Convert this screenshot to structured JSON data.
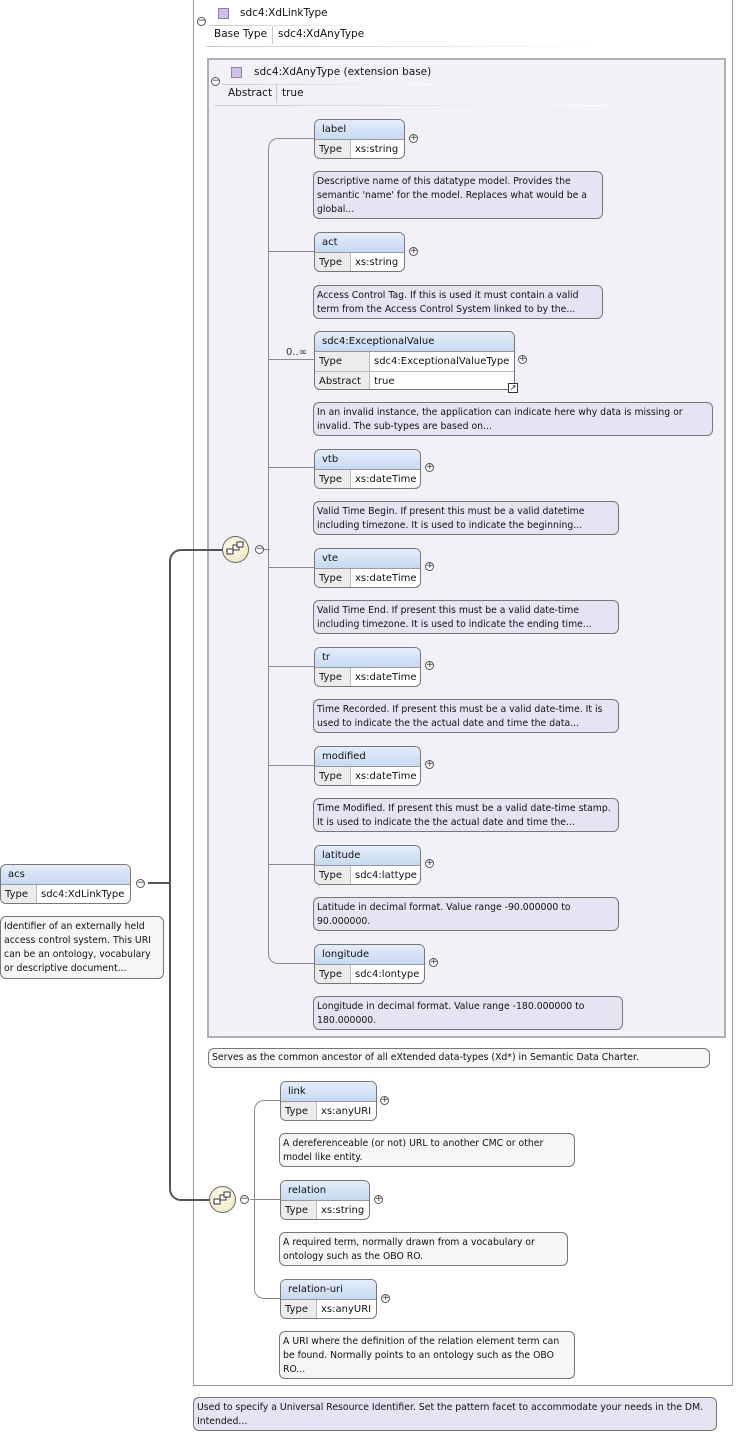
{
  "outer_type": {
    "name": "sdc4:XdLinkType",
    "base_type_key": "Base Type",
    "base_type_val": "sdc4:XdAnyType"
  },
  "inner_type": {
    "name": "sdc4:XdAnyType (extension base)",
    "abstract_key": "Abstract",
    "abstract_val": "true",
    "doc": "Serves as the common ancestor of all eXtended data-types (Xd*) in Semantic Data Charter."
  },
  "root": {
    "name": "acs",
    "type_key": "Type",
    "type_val": "sdc4:XdLinkType",
    "doc": "Identifier of an externally held access control system. This URI can be an ontology, vocabulary or descriptive document..."
  },
  "inner_elements": [
    {
      "name": "label",
      "type": "xs:string",
      "doc": "Descriptive name of this datatype model. Provides the semantic 'name' for the model. Replaces what would be a global..."
    },
    {
      "name": "act",
      "type": "xs:string",
      "doc": "Access Control Tag. If this is used it must contain a valid term from the Access Control System linked to by the..."
    },
    {
      "name": "sdc4:ExceptionalValue",
      "type": "sdc4:ExceptionalValueType",
      "abstract_key": "Abstract",
      "abstract_val": "true",
      "multiplicity": "0..∞",
      "doc": "In an invalid instance, the application can indicate here why data is missing or invalid. The sub-types are based on..."
    },
    {
      "name": "vtb",
      "type": "xs:dateTime",
      "doc": "Valid Time Begin. If present this must be a valid datetime including timezone. It is used to indicate the beginning..."
    },
    {
      "name": "vte",
      "type": "xs:dateTime",
      "doc": "Valid Time End. If present this must be a valid date-time including timezone. It is used to indicate the ending time..."
    },
    {
      "name": "tr",
      "type": "xs:dateTime",
      "doc": "Time Recorded. If present this must be a valid date-time. It is used to indicate the the actual date and time the data..."
    },
    {
      "name": "modified",
      "type": "xs:dateTime",
      "doc": "Time Modified. If present this must be a valid date-time stamp. It is used to indicate the the actual date and time the..."
    },
    {
      "name": "latitude",
      "type": "sdc4:lattype",
      "doc": "Latitude in decimal format. Value range -90.000000 to 90.000000."
    },
    {
      "name": "longitude",
      "type": "sdc4:lontype",
      "doc": "Longitude in decimal format. Value range -180.000000 to 180.000000."
    }
  ],
  "outer_elements": [
    {
      "name": "link",
      "type": "xs:anyURI",
      "doc": "A dereferenceable (or not) URL to another CMC or other model like entity."
    },
    {
      "name": "relation",
      "type": "xs:string",
      "doc": "A required term, normally drawn from a vocabulary or ontology such as the OBO RO."
    },
    {
      "name": "relation-uri",
      "type": "xs:anyURI",
      "doc": "A URI where the definition of the relation element term can be found. Normally points to an ontology such as the OBO RO..."
    }
  ],
  "type_key": "Type",
  "bottom_doc": "Used to specify a Universal Resource Identifier. Set the pattern facet to accommodate your needs in the DM. Intended...",
  "colors": {
    "element_header": "#c8d9f1",
    "type_frame": "#f3f1f8",
    "doc_lilac": "#e8e3f2",
    "sequence": "#ede4bd"
  }
}
